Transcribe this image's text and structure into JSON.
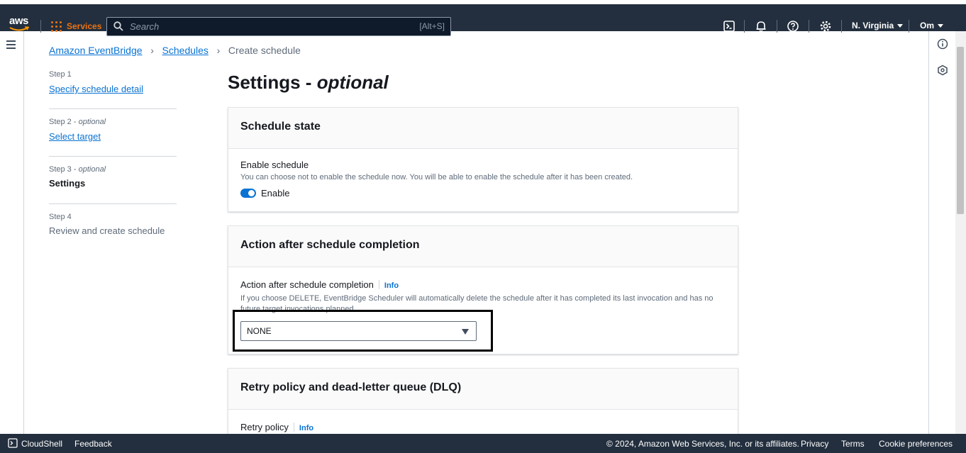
{
  "topnav": {
    "logo_text": "aws",
    "services_label": "Services",
    "search_placeholder": "Search",
    "search_shortcut": "[Alt+S]",
    "region": "N. Virginia",
    "user": "Om"
  },
  "breadcrumb": {
    "items": [
      "Amazon EventBridge",
      "Schedules"
    ],
    "current": "Create schedule",
    "separator": "›"
  },
  "steps": [
    {
      "num": "Step 1",
      "optional": "",
      "label": "Specify schedule detail",
      "state": "link"
    },
    {
      "num": "Step 2",
      "optional": "optional",
      "label": "Select target",
      "state": "link"
    },
    {
      "num": "Step 3",
      "optional": "optional",
      "label": "Settings",
      "state": "active"
    },
    {
      "num": "Step 4",
      "optional": "",
      "label": "Review and create schedule",
      "state": "disabled"
    }
  ],
  "page_title": {
    "main": "Settings",
    "dash": " - ",
    "suffix": "optional"
  },
  "schedule_state": {
    "header": "Schedule state",
    "field_label": "Enable schedule",
    "description": "You can choose not to enable the schedule now. You will be able to enable the schedule after it has been created.",
    "toggle_label": "Enable",
    "toggle_on": true
  },
  "action_after": {
    "header": "Action after schedule completion",
    "field_label": "Action after schedule completion",
    "info": "Info",
    "description": "If you choose DELETE, EventBridge Scheduler will automatically delete the schedule after it has completed its last invocation and has no future target invocations planned.",
    "selected": "NONE"
  },
  "retry": {
    "header": "Retry policy and dead-letter queue (DLQ)",
    "field_label": "Retry policy",
    "info": "Info"
  },
  "footer": {
    "cloudshell": "CloudShell",
    "feedback": "Feedback",
    "copyright": "© 2024, Amazon Web Services, Inc. or its affiliates.",
    "privacy": "Privacy",
    "terms": "Terms",
    "cookie": "Cookie preferences"
  },
  "colors": {
    "nav_bg": "#232f3e",
    "accent_orange": "#ec7211",
    "link_blue": "#0972d3"
  }
}
